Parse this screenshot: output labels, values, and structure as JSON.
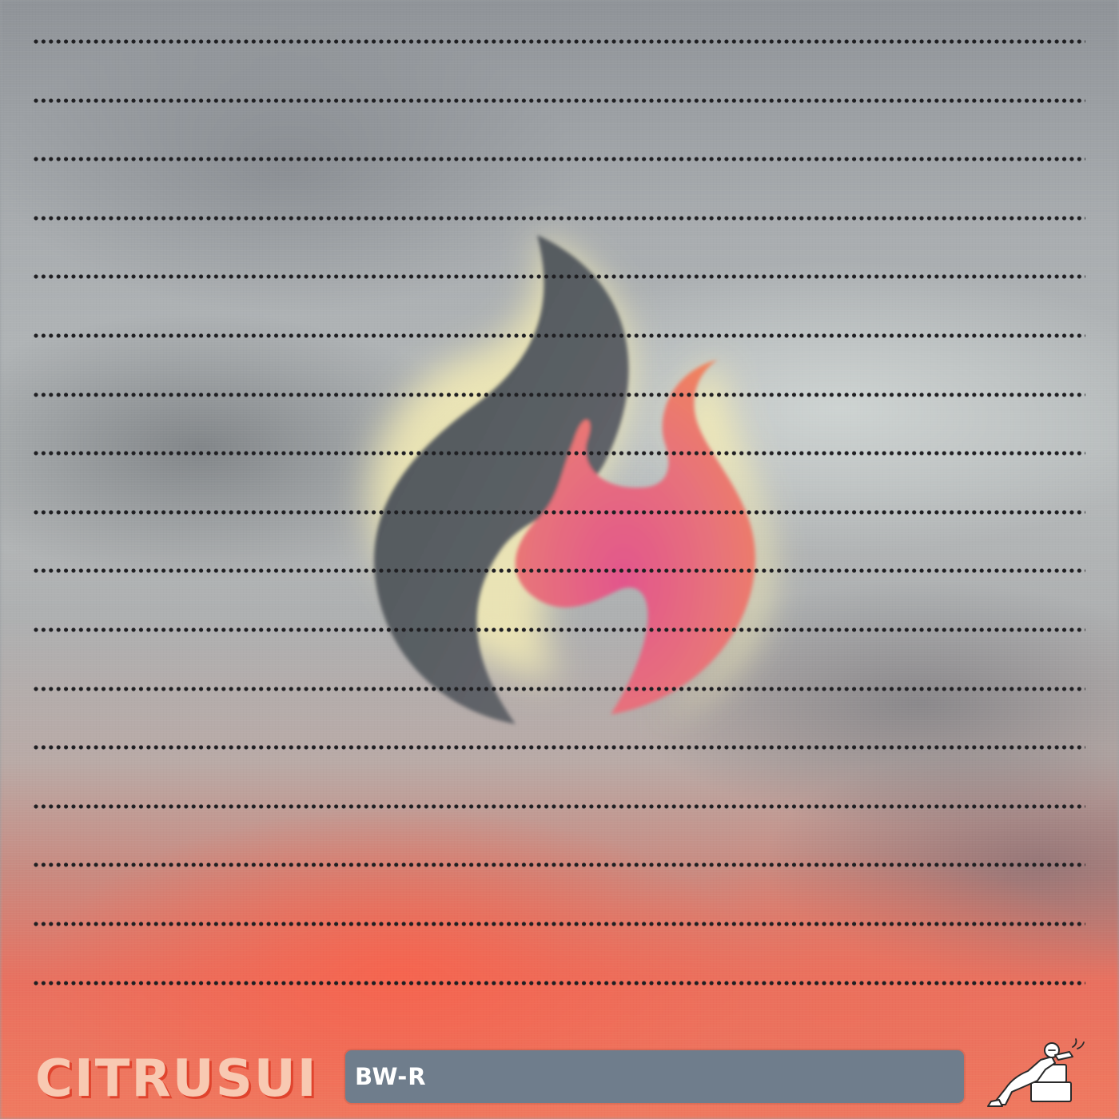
{
  "brand": {
    "name": "CITRUSUI"
  },
  "label_bar": {
    "text": "BW-R"
  },
  "icons": {
    "flame": "flame-icon",
    "mascot": "reclining-figure-icon"
  },
  "colors": {
    "brand_text": "#f8c9b2",
    "brand_shadow": "#e0442e",
    "label_bar_bg": "#6f7d8c",
    "flame_dark": "#585d63",
    "flame_pink": "#e3608a",
    "flame_orange": "#ef7a5f",
    "flame_glow": "#f2e9b0",
    "dots": "#1f1f22"
  },
  "dotted_line_count": 17
}
